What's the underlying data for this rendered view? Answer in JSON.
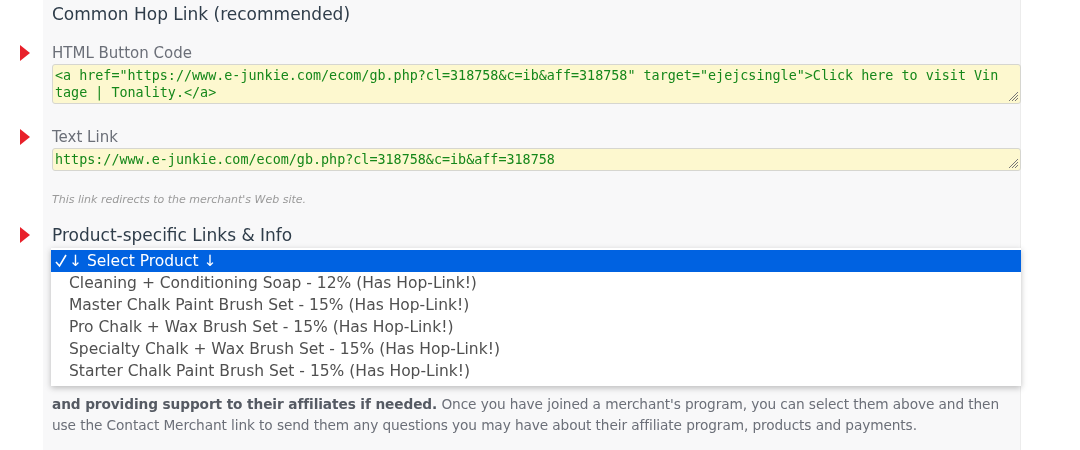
{
  "hop_link": {
    "title": "Common Hop Link (recommended)",
    "fields": [
      {
        "label": "HTML Button Code",
        "value": "<a href=\"https://www.e-junkie.com/ecom/gb.php?cl=318758&c=ib&aff=318758\" target=\"ejejcsingle\">Click here to visit Vintage | Tonality.</a>"
      },
      {
        "label": "Text Link",
        "value": "https://www.e-junkie.com/ecom/gb.php?cl=318758&c=ib&aff=318758"
      }
    ],
    "note": "This link redirects to the merchant's Web site."
  },
  "product_links": {
    "title": "Product-specific Links & Info",
    "options": [
      {
        "label": "↓ Select Product ↓",
        "selected": true
      },
      {
        "label": "Cleaning + Conditioning Soap - 12% (Has Hop-Link!)",
        "selected": false
      },
      {
        "label": "Master Chalk Paint Brush Set - 15% (Has Hop-Link!)",
        "selected": false
      },
      {
        "label": "Pro Chalk + Wax Brush Set - 15% (Has Hop-Link!)",
        "selected": false
      },
      {
        "label": "Specialty Chalk + Wax Brush Set - 15% (Has Hop-Link!)",
        "selected": false
      },
      {
        "label": "Starter Chalk Paint Brush Set - 15% (Has Hop-Link!)",
        "selected": false
      }
    ]
  },
  "info_text": "**and providing support to their affiliates if needed.** Once you have joined a merchant's program, you can select them above and then use the Contact Merchant link to send them any questions you may have about their affiliate program, products and payments."
}
